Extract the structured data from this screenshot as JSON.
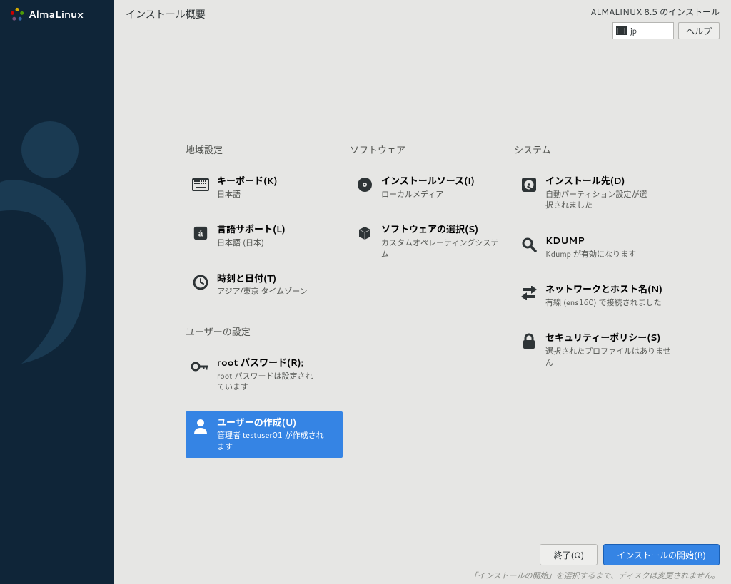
{
  "brand": "AlmaLinux",
  "header": {
    "page_title": "インストール概要",
    "install_title": "ALMALINUX 8.5 のインストール",
    "keyboard_layout": "jp",
    "help_label": "ヘルプ"
  },
  "categories": {
    "localization": {
      "title": "地域設定",
      "keyboard": {
        "title": "キーボード(K)",
        "sub": "日本語"
      },
      "language": {
        "title": "言語サポート(L)",
        "sub": "日本語 (日本)"
      },
      "time": {
        "title": "時刻と日付(T)",
        "sub": "アジア/東京 タイムゾーン"
      }
    },
    "software": {
      "title": "ソフトウェア",
      "source": {
        "title": "インストールソース(I)",
        "sub": "ローカルメディア"
      },
      "selection": {
        "title": "ソフトウェアの選択(S)",
        "sub": "カスタムオペレーティングシステム"
      }
    },
    "system": {
      "title": "システム",
      "destination": {
        "title": "インストール先(D)",
        "sub": "自動パーティション設定が選択されました"
      },
      "kdump": {
        "title": "KDUMP",
        "sub": "Kdump が有効になります"
      },
      "network": {
        "title": "ネットワークとホスト名(N)",
        "sub": "有線 (ens160) で接続されました"
      },
      "security": {
        "title": "セキュリティーポリシー(S)",
        "sub": "選択されたプロファイルはありません"
      }
    },
    "user": {
      "title": "ユーザーの設定",
      "root": {
        "title": "root パスワード(R):",
        "sub": "root パスワードは設定されています"
      },
      "create": {
        "title": "ユーザーの作成(U)",
        "sub": "管理者 testuser01 が作成されます"
      }
    }
  },
  "footer": {
    "quit_label": "終了(Q)",
    "begin_label": "インストールの開始(B)",
    "note": "「インストールの開始」を選択するまで、ディスクは変更されません。"
  }
}
